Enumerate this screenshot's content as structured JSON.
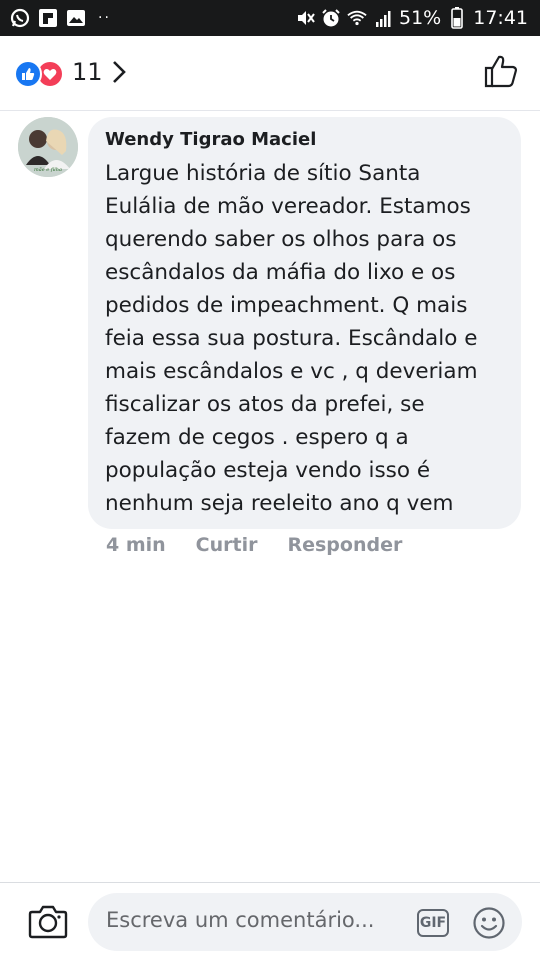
{
  "status_bar": {
    "battery": "51%",
    "time": "17:41",
    "dots": "··",
    "icons": [
      "whatsapp-icon",
      "flipboard-icon",
      "gallery-icon",
      "mute-icon",
      "alarm-icon",
      "wifi-icon",
      "signal-icon",
      "battery-icon"
    ]
  },
  "reactions": {
    "count": "11",
    "icons": [
      "like-reaction-icon",
      "love-reaction-icon"
    ],
    "like_color": "#1877f2",
    "love_color": "#f33e58"
  },
  "comment": {
    "author": "Wendy Tigrao Maciel",
    "text": "Largue história de sítio Santa\nEulália de mão vereador.  Estamos\nquerendo saber os olhos para os\nescândalos da máfia do lixo e os\npedidos de impeachment.  Q mais\nfeia essa sua postura.  Escândalo e\nmais escândalos e vc , q deveriam\nfiscalizar os atos da prefei, se\nfazem de cegos . espero q a\npopulação esteja vendo isso é\nnenhum seja reeleito ano q vem",
    "time": "4 min",
    "like_label": "Curtir",
    "reply_label": "Responder"
  },
  "composer": {
    "placeholder": "Escreva um comentário...",
    "gif_label": "GIF"
  }
}
